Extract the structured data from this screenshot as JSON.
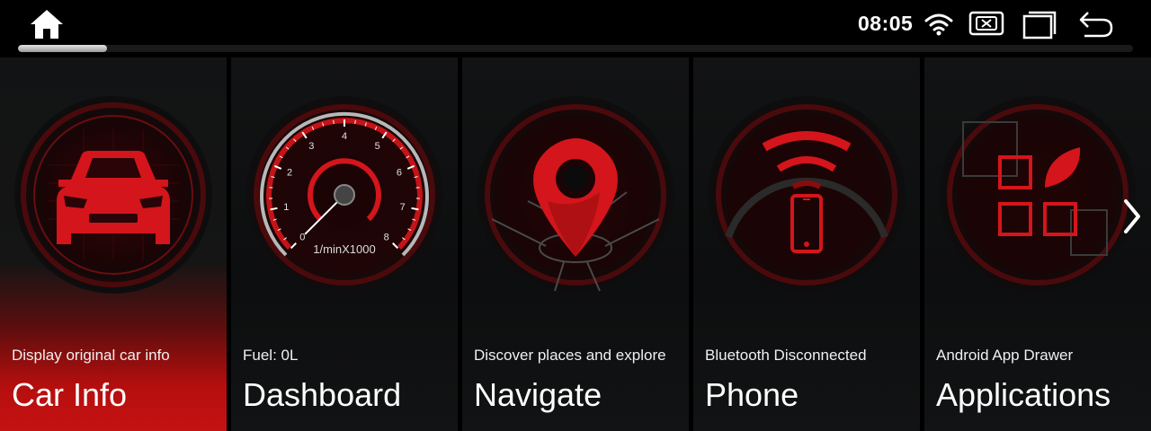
{
  "status_bar": {
    "time": "08:05",
    "icons": [
      "home-icon",
      "wifi-icon",
      "close-box-icon",
      "recent-apps-icon",
      "back-arrow-icon"
    ]
  },
  "progress": {
    "fraction": 0.08
  },
  "cards": [
    {
      "subtitle": "Display original car info",
      "title": "Car Info",
      "icon": "car-icon",
      "active": true
    },
    {
      "subtitle": "Fuel: 0L",
      "title": "Dashboard",
      "icon": "tachometer-icon",
      "active": false
    },
    {
      "subtitle": "Discover places and explore",
      "title": "Navigate",
      "icon": "map-pin-icon",
      "active": false
    },
    {
      "subtitle": "Bluetooth Disconnected",
      "title": "Phone",
      "icon": "phone-signal-icon",
      "active": false
    },
    {
      "subtitle": "Android App Drawer",
      "title": "Applications",
      "icon": "app-grid-icon",
      "active": false
    }
  ],
  "tachometer": {
    "ticks": [
      "0",
      "1",
      "2",
      "3",
      "4",
      "5",
      "6",
      "7",
      "8"
    ],
    "unit": "1/minX1000",
    "value": 0
  },
  "colors": {
    "accent": "#e4161b",
    "active_card": "#c51212",
    "background": "#000000"
  }
}
